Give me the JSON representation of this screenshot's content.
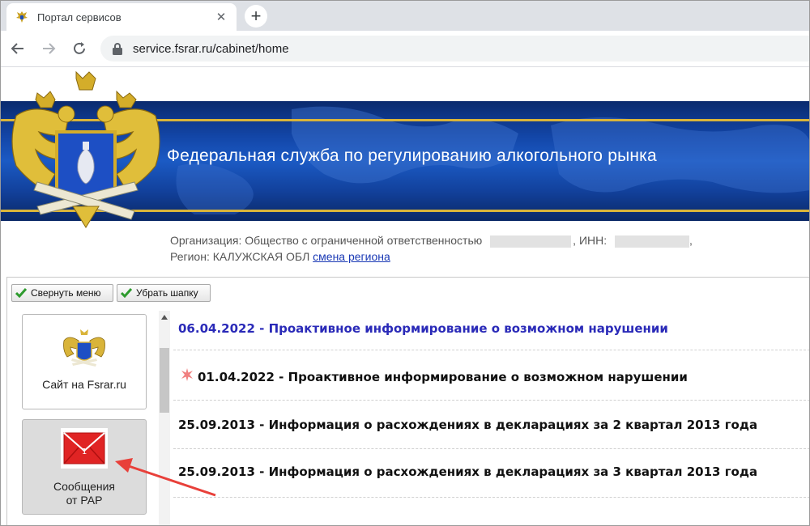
{
  "browser": {
    "tab_title": "Портал сервисов",
    "new_tab_symbol": "+",
    "close_symbol": "✕",
    "url": "service.fsrar.ru/cabinet/home"
  },
  "header": {
    "title": "Федеральная служба по регулированию алкогольного рынка",
    "org_label": "Организация: Общество с ограниченной ответственностью",
    "inn_label": ", ИНН:",
    "trailing_comma": ",",
    "region_label": "Регион: КАЛУЖСКАЯ ОБЛ",
    "region_link": "смена региона"
  },
  "toolbar": {
    "collapse_menu": "Свернуть меню",
    "hide_header": "Убрать шапку"
  },
  "menu": {
    "site_tile": "Сайт на Fsrar.ru",
    "messages_tile_line1": "Сообщения",
    "messages_tile_line2": "от РАР"
  },
  "news": [
    "06.04.2022 - Проактивное информирование о возможном нарушении",
    "01.04.2022 - Проактивное информирование о возможном нарушении",
    "25.09.2013 - Информация о расхождениях в декларациях за 2 квартал 2013 года",
    "25.09.2013 - Информация о расхождениях в декларациях за 3 квартал 2013 года"
  ],
  "colors": {
    "banner_blue": "#1346a8",
    "gold": "#d9b43a",
    "news_highlight": "#2a2ab8",
    "link": "#1a39b5",
    "annotation_arrow": "#e8403a"
  }
}
